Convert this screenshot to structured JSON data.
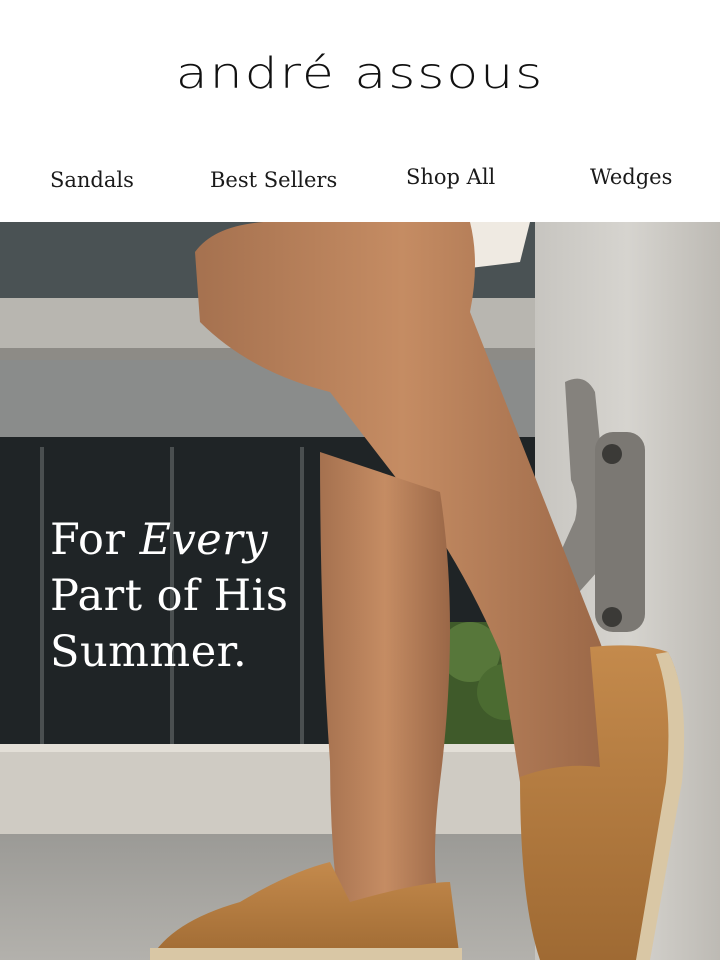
{
  "brand": {
    "logo_text": "andré assous"
  },
  "nav": {
    "items": [
      {
        "label": "Sandals"
      },
      {
        "label": "Best Sellers"
      },
      {
        "label": "Shop All"
      },
      {
        "label": "Wedges"
      }
    ]
  },
  "hero": {
    "headline_prefix": "For ",
    "headline_emphasis": "Every",
    "headline_line2": "Part of His",
    "headline_line3": "Summer."
  },
  "colors": {
    "background": "#ffffff",
    "text_dark": "#111111",
    "headline_text": "#ffffff",
    "shoe_suede": "#b47a3e",
    "espadrille_sole": "#d9c7a5"
  }
}
